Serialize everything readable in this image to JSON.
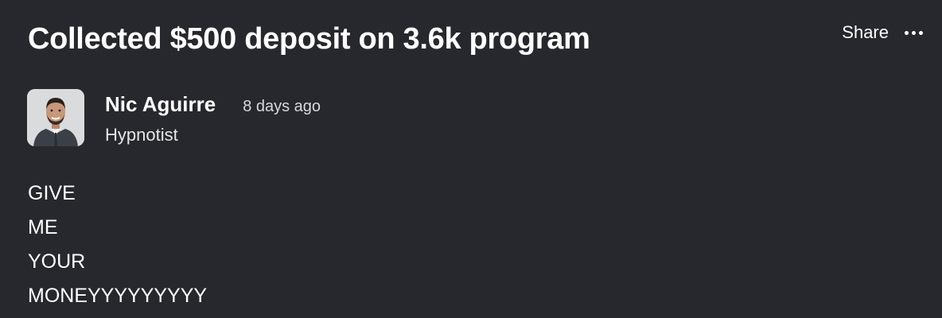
{
  "post": {
    "title": "Collected $500 deposit on 3.6k program",
    "actions": {
      "share_label": "Share",
      "more_icon": "more-horizontal-icon"
    },
    "author": {
      "name": "Nic Aguirre",
      "role": "Hypnotist",
      "time_ago": "8 days ago"
    },
    "body_lines": [
      "GIVE",
      "ME",
      "YOUR",
      "MONEYYYYYYYYY"
    ]
  },
  "colors": {
    "background": "#27282d",
    "text": "#ffffff",
    "muted_text": "#d8d8dc"
  }
}
